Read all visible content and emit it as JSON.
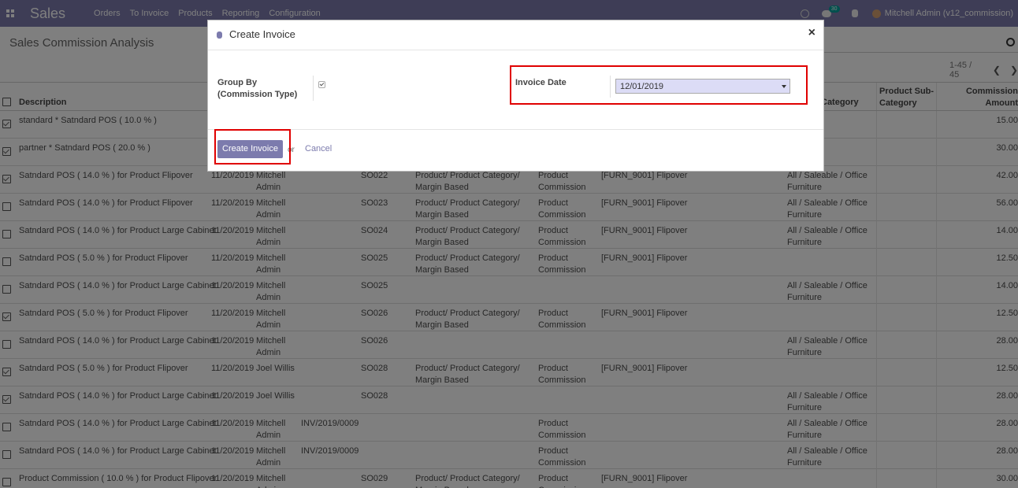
{
  "nav": {
    "brand": "Sales",
    "menu": [
      "Orders",
      "To Invoice",
      "Products",
      "Reporting",
      "Configuration"
    ],
    "chat_count": "30",
    "user": "Mitchell Admin (v12_commission)"
  },
  "page": {
    "title": "Sales Commission Analysis",
    "pager": "1-45 / 45"
  },
  "table": {
    "headers": [
      "Description",
      "Category",
      "Product Sub-\nCategory",
      "Commission\nAmount"
    ],
    "rows": [
      {
        "checked": true,
        "desc": "standard * Satndard POS ( 10.0 % )",
        "date": "",
        "user": "",
        "inv": "",
        "so": "",
        "rule": "",
        "type": "",
        "product": "",
        "categ": "",
        "amount": "15.00"
      },
      {
        "checked": true,
        "desc": "partner * Satndard POS ( 20.0 % )",
        "date": "",
        "user": "",
        "inv": "",
        "so": "",
        "rule": "",
        "type": "",
        "product": "",
        "categ": "",
        "amount": "30.00"
      },
      {
        "checked": true,
        "desc": "Satndard POS ( 14.0 % ) for Product Flipover",
        "date": "11/20/2019",
        "user": "Mitchell\nAdmin",
        "inv": "",
        "so": "SO022",
        "rule": "Product/ Product Category/\nMargin Based",
        "type": "Product\nCommission",
        "product": "[FURN_9001] Flipover",
        "categ": "All / Saleable / Office\nFurniture",
        "amount": "42.00"
      },
      {
        "checked": false,
        "desc": "Satndard POS ( 14.0 % ) for Product Flipover",
        "date": "11/20/2019",
        "user": "Mitchell\nAdmin",
        "inv": "",
        "so": "SO023",
        "rule": "Product/ Product Category/\nMargin Based",
        "type": "Product\nCommission",
        "product": "[FURN_9001] Flipover",
        "categ": "All / Saleable / Office\nFurniture",
        "amount": "56.00"
      },
      {
        "checked": false,
        "desc": "Satndard POS ( 14.0 % ) for Product Large Cabinet",
        "date": "11/20/2019",
        "user": "Mitchell\nAdmin",
        "inv": "",
        "so": "SO024",
        "rule": "Product/ Product Category/\nMargin Based",
        "type": "Product\nCommission",
        "product": "[FURN_9001] Flipover",
        "categ": "All / Saleable / Office\nFurniture",
        "amount": "14.00"
      },
      {
        "checked": false,
        "desc": "Satndard POS ( 5.0 % ) for Product Flipover",
        "date": "11/20/2019",
        "user": "Mitchell\nAdmin",
        "inv": "",
        "so": "SO025",
        "rule": "Product/ Product Category/\nMargin Based",
        "type": "Product\nCommission",
        "product": "[FURN_9001] Flipover",
        "categ": "",
        "amount": "12.50"
      },
      {
        "checked": false,
        "desc": "Satndard POS ( 14.0 % ) for Product Large Cabinet",
        "date": "11/20/2019",
        "user": "Mitchell\nAdmin",
        "inv": "",
        "so": "SO025",
        "rule": "",
        "type": "",
        "product": "",
        "categ": "All / Saleable / Office\nFurniture",
        "amount": "14.00"
      },
      {
        "checked": true,
        "desc": "Satndard POS ( 5.0 % ) for Product Flipover",
        "date": "11/20/2019",
        "user": "Mitchell\nAdmin",
        "inv": "",
        "so": "SO026",
        "rule": "Product/ Product Category/\nMargin Based",
        "type": "Product\nCommission",
        "product": "[FURN_9001] Flipover",
        "categ": "",
        "amount": "12.50"
      },
      {
        "checked": false,
        "desc": "Satndard POS ( 14.0 % ) for Product Large Cabinet",
        "date": "11/20/2019",
        "user": "Mitchell\nAdmin",
        "inv": "",
        "so": "SO026",
        "rule": "",
        "type": "",
        "product": "",
        "categ": "All / Saleable / Office\nFurniture",
        "amount": "28.00"
      },
      {
        "checked": true,
        "desc": "Satndard POS ( 5.0 % ) for Product Flipover",
        "date": "11/20/2019",
        "user": "Joel Willis",
        "inv": "",
        "so": "SO028",
        "rule": "Product/ Product Category/\nMargin Based",
        "type": "Product\nCommission",
        "product": "[FURN_9001] Flipover",
        "categ": "",
        "amount": "12.50"
      },
      {
        "checked": true,
        "desc": "Satndard POS ( 14.0 % ) for Product Large Cabinet",
        "date": "11/20/2019",
        "user": "Joel Willis",
        "inv": "",
        "so": "SO028",
        "rule": "",
        "type": "",
        "product": "",
        "categ": "All / Saleable / Office\nFurniture",
        "amount": "28.00"
      },
      {
        "checked": false,
        "desc": "Satndard POS ( 14.0 % ) for Product Large Cabinet",
        "date": "11/20/2019",
        "user": "Mitchell\nAdmin",
        "inv": "INV/2019/0009",
        "so": "",
        "rule": "",
        "type": "Product\nCommission",
        "product": "",
        "categ": "All / Saleable / Office\nFurniture",
        "amount": "28.00"
      },
      {
        "checked": false,
        "desc": "Satndard POS ( 14.0 % ) for Product Large Cabinet",
        "date": "11/20/2019",
        "user": "Mitchell\nAdmin",
        "inv": "INV/2019/0009",
        "so": "",
        "rule": "",
        "type": "Product\nCommission",
        "product": "",
        "categ": "All / Saleable / Office\nFurniture",
        "amount": "28.00"
      },
      {
        "checked": false,
        "desc": "Product Commission ( 10.0 % ) for Product Flipover",
        "date": "11/20/2019",
        "user": "Mitchell\nAdmin",
        "inv": "",
        "so": "SO029",
        "rule": "Product/ Product Category/\nMargin Based",
        "type": "Product\nCommission",
        "product": "[FURN_9001] Flipover",
        "categ": "",
        "amount": "30.00"
      }
    ]
  },
  "modal": {
    "title": "Create Invoice",
    "close": "×",
    "group_by_label": "Group By\n(Commission Type)",
    "group_by_checked": true,
    "invoice_date_label": "Invoice Date",
    "invoice_date_value": "12/01/2019",
    "create_button": "Create Invoice",
    "or_text": "or",
    "cancel_button": "Cancel"
  },
  "colors": {
    "brand": "#7c7bad",
    "highlight": "#e00000"
  }
}
